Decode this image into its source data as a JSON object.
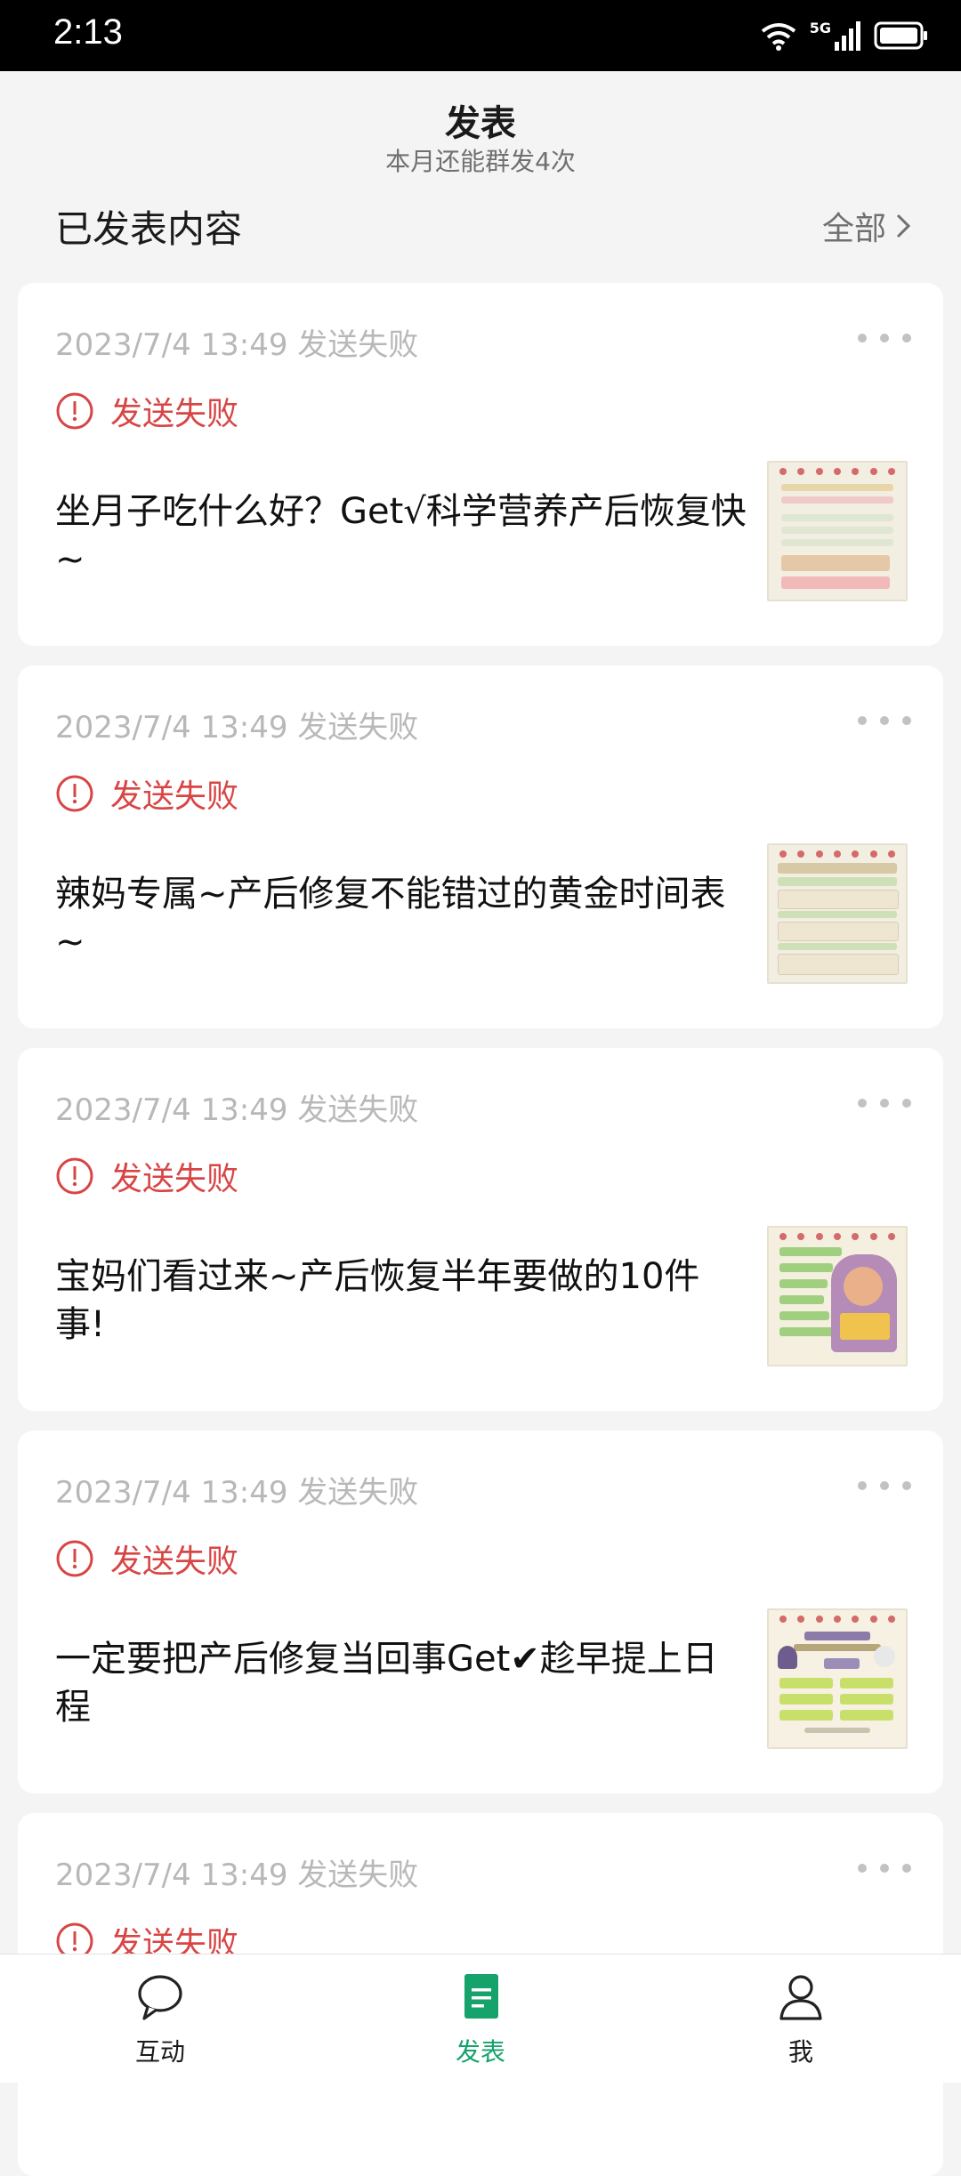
{
  "status_bar": {
    "time": "2:13",
    "network": "5G"
  },
  "header": {
    "title": "发表",
    "subtitle": "本月还能群发4次"
  },
  "section": {
    "label": "已发表内容",
    "all_link": "全部"
  },
  "cards": [
    {
      "meta": "2023/7/4 13:49 发送失败",
      "status": "发送失败",
      "content": "坐月子吃什么好？Get√科学营养产后恢复快~"
    },
    {
      "meta": "2023/7/4 13:49 发送失败",
      "status": "发送失败",
      "content": "辣妈专属~产后修复不能错过的黄金时间表~"
    },
    {
      "meta": "2023/7/4 13:49 发送失败",
      "status": "发送失败",
      "content": "宝妈们看过来~产后恢复半年要做的10件事!"
    },
    {
      "meta": "2023/7/4 13:49 发送失败",
      "status": "发送失败",
      "content": "一定要把产后修复当回事Get✔趁早提上日程"
    },
    {
      "meta": "2023/7/4 13:49 发送失败",
      "status": "发送失败",
      "content": ""
    }
  ],
  "nav": [
    {
      "label": "互动",
      "icon": "chat-bubble-icon"
    },
    {
      "label": "发表",
      "icon": "document-icon",
      "active": true
    },
    {
      "label": "我",
      "icon": "person-icon"
    }
  ],
  "colors": {
    "accent": "#15a26b",
    "error": "#d84545",
    "muted": "#b8b8b8"
  }
}
